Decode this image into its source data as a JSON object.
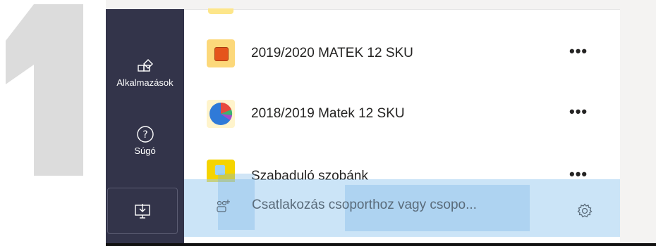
{
  "step_number": "1",
  "rail": {
    "items": [
      {
        "label": "Alkalmazások",
        "icon": "apps-icon"
      },
      {
        "label": "Súgó",
        "icon": "help-icon"
      }
    ],
    "download_icon": "download-app-icon"
  },
  "teams": [
    {
      "name": "2019/2020 MATEK 12 SKU",
      "avatar": "orange-square",
      "more": "•••"
    },
    {
      "name": "2018/2019 Matek 12 SKU",
      "avatar": "pie-chart",
      "more": "•••"
    },
    {
      "name": "Szabaduló szobánk",
      "avatar": "yellow-image",
      "more": "•••"
    }
  ],
  "footer": {
    "join_label": "Csatlakozás csoporthoz vagy csopo...",
    "join_icon": "join-team-icon",
    "settings_icon": "gear-icon"
  },
  "colors": {
    "rail_bg": "#33344a",
    "highlight": "#a0cdf0",
    "big_number": "#dcdcdc"
  }
}
